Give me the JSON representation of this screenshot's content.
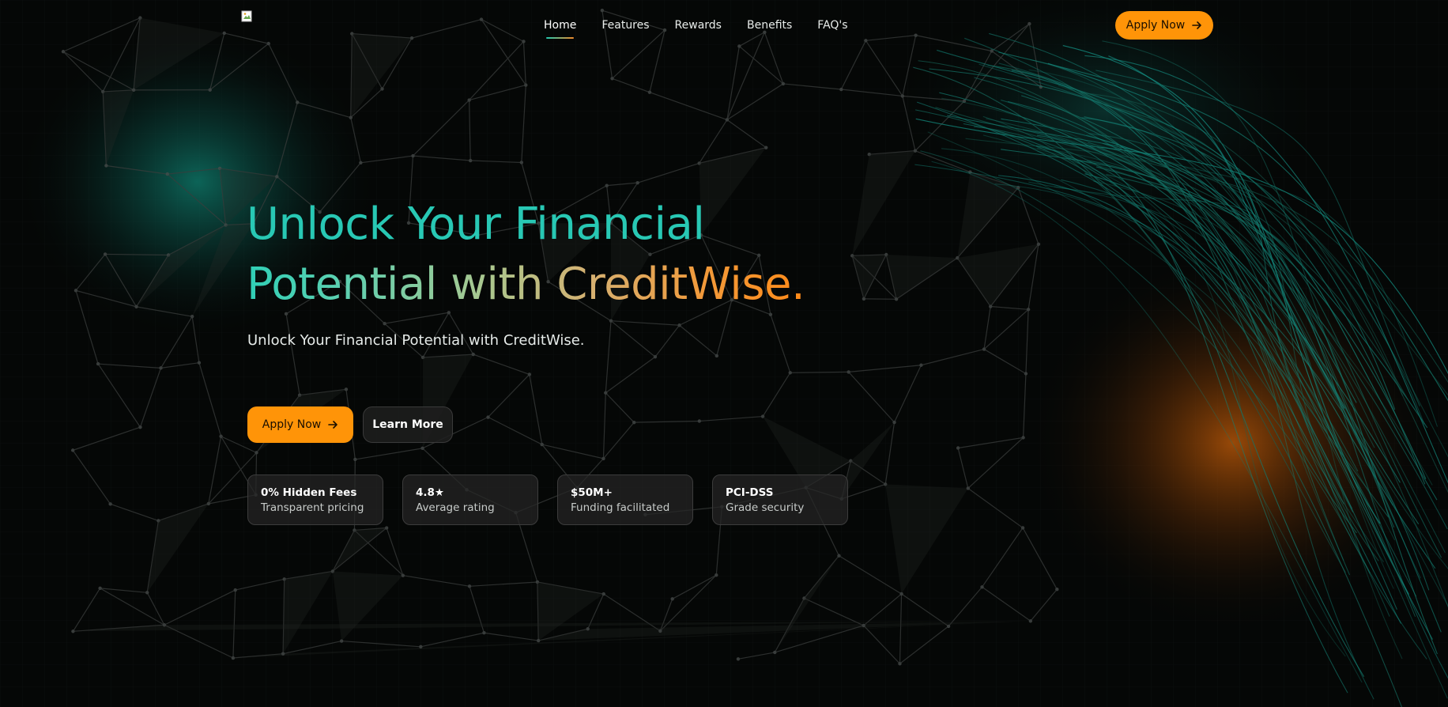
{
  "nav": {
    "items": [
      {
        "label": "Home",
        "active": true
      },
      {
        "label": "Features",
        "active": false
      },
      {
        "label": "Rewards",
        "active": false
      },
      {
        "label": "Benefits",
        "active": false
      },
      {
        "label": "FAQ's",
        "active": false
      }
    ],
    "cta_label": "Apply Now",
    "logo_icon": "broken-image-icon"
  },
  "hero": {
    "title_line1": "Unlock Your Financial",
    "title_line2": "Potential with CreditWise.",
    "subtitle": "Unlock Your Financial Potential with CreditWise.",
    "primary_cta": "Apply Now",
    "secondary_cta": "Learn More"
  },
  "stats": [
    {
      "value": "0% Hidden Fees",
      "label": "Transparent pricing"
    },
    {
      "value": "4.8★",
      "label": "Average rating"
    },
    {
      "value": "$50M+",
      "label": "Funding facilitated"
    },
    {
      "value": "PCI-DSS",
      "label": "Grade security"
    }
  ],
  "colors": {
    "accent_orange": "#ff9408",
    "accent_teal": "#28c8b4",
    "background": "#050706"
  }
}
